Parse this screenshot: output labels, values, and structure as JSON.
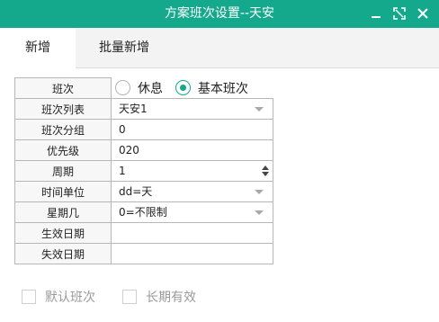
{
  "window": {
    "title": "方案班次设置--天安",
    "controls": [
      "minimize-icon",
      "maximize-icon",
      "close-icon"
    ],
    "accent_color": "#14a88d"
  },
  "tabs": [
    {
      "label": "新增",
      "active": true
    },
    {
      "label": "批量新增",
      "active": false
    }
  ],
  "form": {
    "shift_label": "班次",
    "shift_options": [
      {
        "label": "休息",
        "selected": false
      },
      {
        "label": "基本班次",
        "selected": true
      }
    ],
    "rows": [
      {
        "label": "班次列表",
        "value": "天安1",
        "control": "dropdown"
      },
      {
        "label": "班次分组",
        "value": "0",
        "control": "text"
      },
      {
        "label": "优先级",
        "value": "020",
        "control": "text"
      },
      {
        "label": "周期",
        "value": "1",
        "control": "spinner"
      },
      {
        "label": "时间单位",
        "value": "dd=天",
        "control": "dropdown"
      },
      {
        "label": "星期几",
        "value": "0=不限制",
        "control": "dropdown"
      },
      {
        "label": "生效日期",
        "value": "",
        "control": "date"
      },
      {
        "label": "失效日期",
        "value": "",
        "control": "date"
      }
    ]
  },
  "checkboxes": [
    {
      "label": "默认班次",
      "checked": false
    },
    {
      "label": "长期有效",
      "checked": false
    }
  ]
}
